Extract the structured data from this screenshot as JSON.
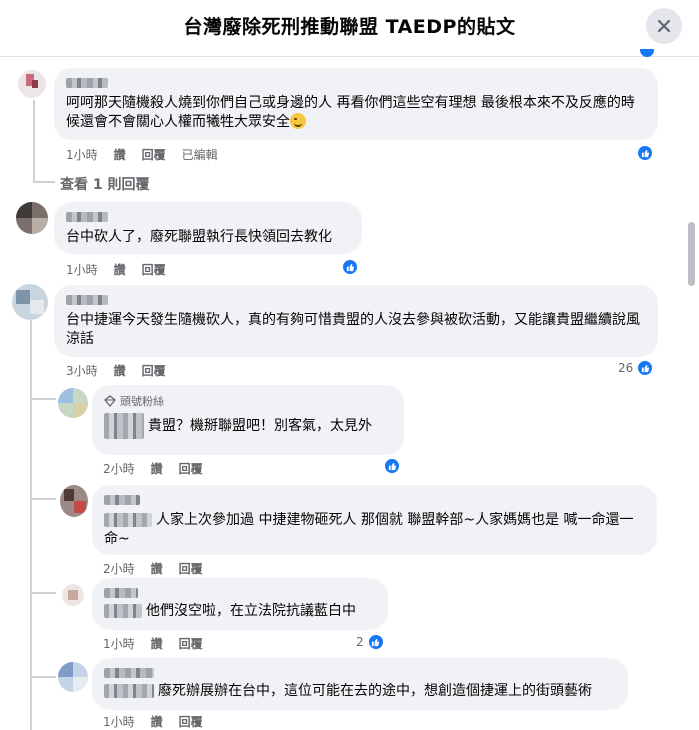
{
  "header": {
    "title": "台灣廢除死刑推動聯盟 TAEDP的貼文"
  },
  "icons": {
    "close": "close-icon",
    "like": "like-icon",
    "badge": "diamond-badge-icon",
    "emoji": "winking-face-icon"
  },
  "colors": {
    "accent": "#1877f2",
    "bubble": "#f0f2f5",
    "meta": "#65676b",
    "text": "#050505"
  },
  "comments": [
    {
      "text": "呵呵那天隨機殺人燒到你們自己或身邊的人 再看你們這些空有理想 最後根本來不及反應的時候還會不會關心人權而犧牲大眾安全",
      "time": "1小時",
      "like": "讚",
      "reply": "回覆",
      "edited": "已編輯",
      "view_replies": "查看 1 則回覆"
    },
    {
      "text": "台中砍人了，廢死聯盟執行長快領回去教化",
      "time": "1小時",
      "like": "讚",
      "reply": "回覆"
    },
    {
      "text": "台中捷運今天發生隨機砍人，真的有夠可惜貴盟的人沒去參與被砍活動，又能讓貴盟繼續說風涼話",
      "time": "3小時",
      "like": "讚",
      "reply": "回覆",
      "reactions": "26"
    }
  ],
  "replies": [
    {
      "badge": "頭號粉絲",
      "text": "貴盟？機掰聯盟吧！別客氣，太見外",
      "time": "2小時",
      "like": "讚",
      "reply": "回覆"
    },
    {
      "text": "人家上次參加過 中捷建物砸死人 那個就 聯盟幹部~人家媽媽也是 喊一命還一命~",
      "time": "2小時",
      "like": "讚",
      "reply": "回覆"
    },
    {
      "text": "他們沒空啦，在立法院抗議藍白中",
      "time": "1小時",
      "like": "讚",
      "reply": "回覆",
      "reactions": "2"
    },
    {
      "text": "廢死辦展辦在台中，這位可能在去的途中，想創造個捷運上的街頭藝術",
      "time": "1小時",
      "like": "讚",
      "reply": "回覆"
    }
  ]
}
